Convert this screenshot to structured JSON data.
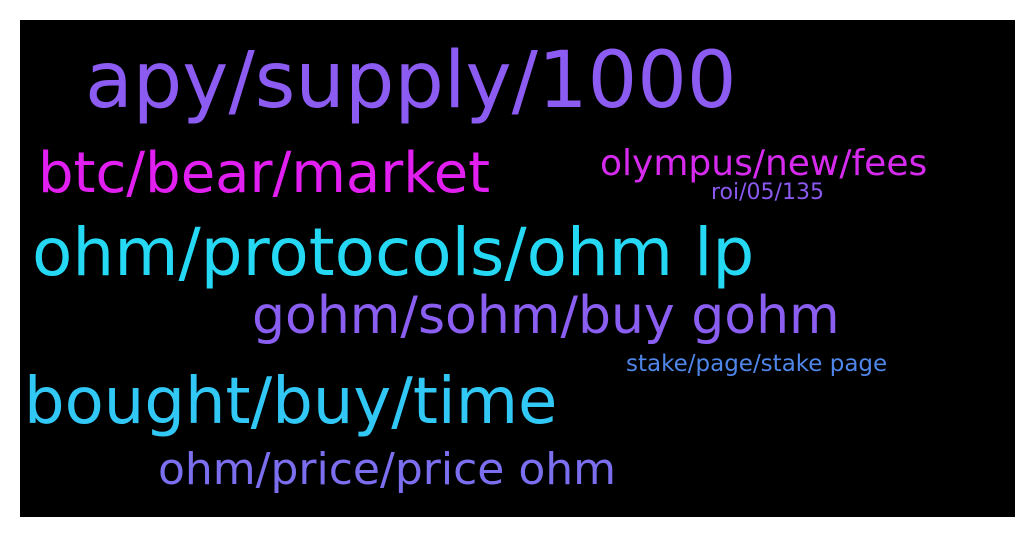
{
  "words": [
    {
      "text": "apy/supply/1000",
      "color": "#8c5cf2"
    },
    {
      "text": "btc/bear/market",
      "color": "#e01ff0"
    },
    {
      "text": "olympus/new/fees",
      "color": "#d62bee"
    },
    {
      "text": "roi/05/135",
      "color": "#8b59ef"
    },
    {
      "text": "ohm/protocols/ohm lp",
      "color": "#25d8f3"
    },
    {
      "text": "gohm/sohm/buy gohm",
      "color": "#8a5ef0"
    },
    {
      "text": "stake/page/stake page",
      "color": "#4f86e9"
    },
    {
      "text": "bought/buy/time",
      "color": "#32c8f5"
    },
    {
      "text": "ohm/price/price ohm",
      "color": "#7b6ff0"
    }
  ]
}
